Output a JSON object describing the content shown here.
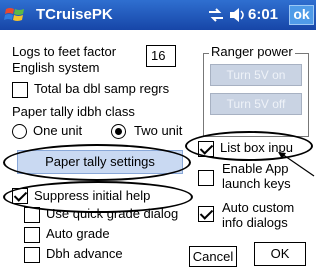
{
  "titlebar": {
    "app_title": "TCruisePK",
    "time": "6:01",
    "ok_label": "ok"
  },
  "form": {
    "logs_to_feet_label": "Logs to feet factor",
    "logs_to_feet_value": "16",
    "english_system_label": "English system",
    "total_ba_label": "Total ba dbl samp regrs",
    "total_ba_checked": false,
    "paper_tally_class_label": "Paper tally idbh class",
    "radio_one_unit_label": "One unit",
    "radio_two_unit_label": "Two unit",
    "radio_selected": "Two unit",
    "paper_tally_button": "Paper tally settings",
    "suppress_help_label": "Suppress initial help",
    "suppress_help_checked": true,
    "quick_grade_label": "Use quick grade dialog",
    "quick_grade_checked": false,
    "auto_grade_label": "Auto grade",
    "auto_grade_checked": false,
    "dbh_advance_label": "Dbh advance",
    "dbh_advance_checked": false
  },
  "ranger_power": {
    "title": "Ranger power",
    "turn_on_label": "Turn 5V on",
    "turn_off_label": "Turn 5V off"
  },
  "right_options": {
    "list_box_label": "List box inpu",
    "list_box_checked": true,
    "enable_app_keys_label_1": "Enable App",
    "enable_app_keys_label_2": "launch keys",
    "enable_app_keys_checked": false,
    "auto_custom_label_1": "Auto custom",
    "auto_custom_label_2": "info dialogs",
    "auto_custom_checked": true
  },
  "footer": {
    "cancel_label": "Cancel",
    "ok_label": "OK"
  },
  "colors": {
    "titlebar": "#1f55b8",
    "accent": "#4f9be8",
    "disabled_button": "#c9d3e3"
  },
  "icons": [
    "windows-logo-icon",
    "signal-icon",
    "volume-icon"
  ]
}
